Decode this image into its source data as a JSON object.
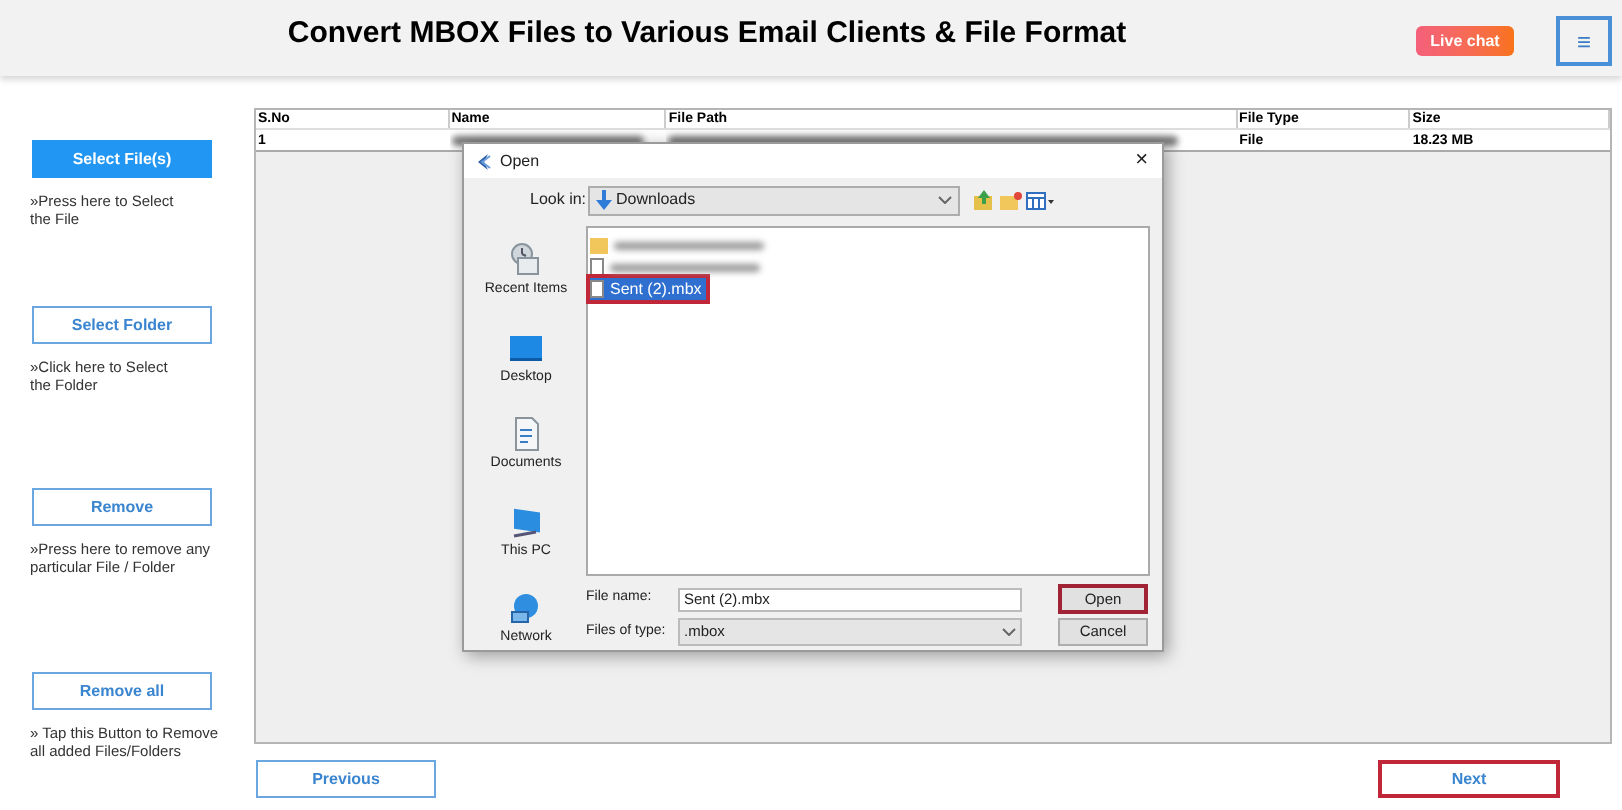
{
  "header": {
    "title": "Convert MBOX Files to Various Email Clients & File Format",
    "live_chat": "Live chat",
    "menu": "≡"
  },
  "sidebar": [
    {
      "label": "Select File(s)",
      "primary": true,
      "hint": "»Press here to Select the File"
    },
    {
      "label": "Select Folder",
      "primary": false,
      "hint": "»Click here to Select the Folder"
    },
    {
      "label": "Remove",
      "primary": false,
      "hint": "»Press here to remove any particular File / Folder"
    },
    {
      "label": "Remove all",
      "primary": false,
      "hint": "» Tap this Button to Remove all added Files/Folders"
    }
  ],
  "table": {
    "columns": [
      "S.No",
      "Name",
      "File Path",
      "File Type",
      "Size"
    ],
    "rows": [
      {
        "cells": [
          "1",
          null,
          null,
          "File",
          "18.23 MB"
        ]
      }
    ]
  },
  "dialog": {
    "title": "Open",
    "look_in_label": "Look in:",
    "look_in": "Downloads",
    "places": [
      {
        "kind": "recent",
        "label": "Recent Items"
      },
      {
        "kind": "desktop",
        "label": "Desktop"
      },
      {
        "kind": "documents",
        "label": "Documents"
      },
      {
        "kind": "pc",
        "label": "This PC"
      },
      {
        "kind": "network",
        "label": "Network"
      }
    ],
    "close": "×",
    "files": [
      {
        "kind": "folder",
        "selected": false,
        "highlighted": false
      },
      {
        "kind": "file",
        "selected": false,
        "highlighted": false
      },
      {
        "kind": "file",
        "name": "Sent (2).mbx",
        "selected": true,
        "highlighted": true
      }
    ],
    "file_name_label": "File name:",
    "file_name": "Sent (2).mbx",
    "file_type_label": "Files of type:",
    "file_type": ".mbox",
    "buttons": [
      {
        "label": "Open",
        "highlighted": true
      },
      {
        "label": "Cancel",
        "highlighted": false
      }
    ]
  },
  "footer": {
    "previous": "Previous",
    "next": {
      "label": "Next",
      "highlighted": true
    }
  }
}
